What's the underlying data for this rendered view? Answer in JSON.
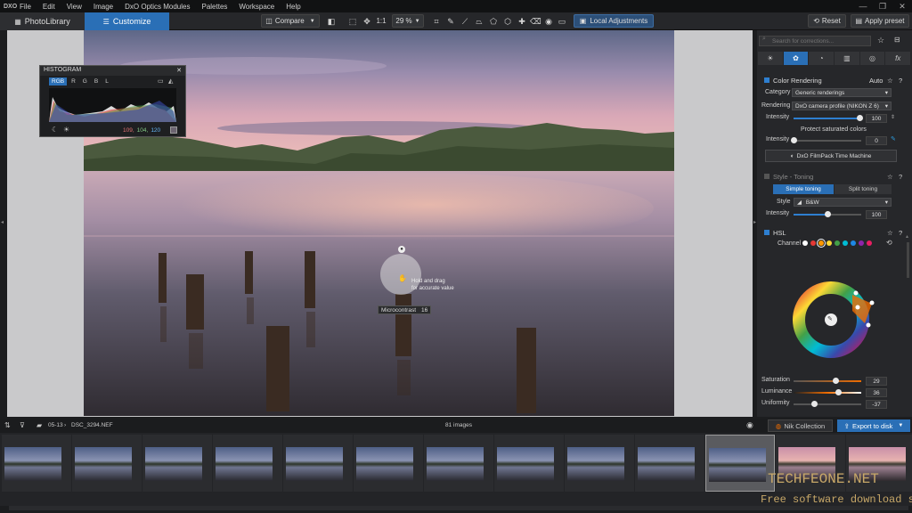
{
  "app": {
    "logo": "DXO"
  },
  "menu": [
    "File",
    "Edit",
    "View",
    "Image",
    "DxO Optics Modules",
    "Palettes",
    "Workspace",
    "Help"
  ],
  "window_controls": [
    "—",
    "❐",
    "✕"
  ],
  "tabs": {
    "photolibrary": "PhotoLibrary",
    "customize": "Customize"
  },
  "toolbar": {
    "compare": "Compare",
    "ratio": "1:1",
    "zoom": "29 %",
    "local_adjustments": "Local Adjustments",
    "reset": "Reset",
    "apply_preset": "Apply preset"
  },
  "histogram": {
    "title": "HISTOGRAM",
    "channels": [
      "RGB",
      "R",
      "G",
      "B",
      "L"
    ],
    "values": {
      "r": "109,",
      "g": "104,",
      "b": "120"
    }
  },
  "viewer": {
    "hint_line1": "Hold and drag",
    "hint_line2": "for accurate value",
    "badge_label": "Microcontrast",
    "badge_value": "16"
  },
  "panel": {
    "search_placeholder": "Search for corrections...",
    "color_rendering": {
      "title": "Color Rendering",
      "auto": "Auto",
      "category_label": "Category",
      "category_value": "Generic renderings",
      "rendering_label": "Rendering",
      "rendering_value": "DxO camera profile (NIKON Z 6)",
      "intensity_label": "Intensity",
      "intensity_value": "100",
      "intensity_fraction": 0.98,
      "protect_label": "Protect saturated colors",
      "protect_intensity_label": "Intensity",
      "protect_value": "0",
      "protect_fraction": 0.0,
      "filmpack_button": "DxO FilmPack Time Machine"
    },
    "style_toning": {
      "title": "Style - Toning",
      "simple": "Simple toning",
      "split": "Split toning",
      "style_label": "Style",
      "style_value": "B&W",
      "intensity_label": "Intensity",
      "intensity_value": "100",
      "intensity_fraction": 0.5
    },
    "hsl": {
      "title": "HSL",
      "channel_label": "Channel",
      "channel_colors": [
        "#ffffff",
        "#e53935",
        "#ff9800",
        "#fdd835",
        "#43a047",
        "#00bcd4",
        "#1e88e5",
        "#8e24aa",
        "#e91e63"
      ],
      "saturation_label": "Saturation",
      "saturation_value": "29",
      "luminance_label": "Luminance",
      "luminance_value": "36",
      "uniformity_label": "Uniformity",
      "uniformity_value": "-37"
    }
  },
  "filmstrip": {
    "path_folder": "05-13",
    "path_file": "DSC_3294.NEF",
    "count": "81 images",
    "nik_collection": "Nik Collection",
    "export": "Export to disk"
  },
  "watermark": {
    "line1": "TECHFEONE.NET",
    "line2": "Free software download site"
  }
}
